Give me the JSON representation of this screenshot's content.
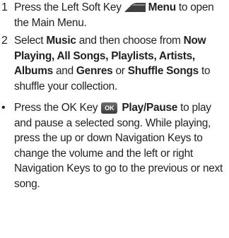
{
  "steps": [
    {
      "marker": "1",
      "pre": "Press the Left Soft Key",
      "icon": "left-soft-key-icon",
      "bold": "Menu",
      "post": " to open the Main Menu."
    },
    {
      "marker": "2",
      "t1": "Select ",
      "b1": "Music",
      "t2": " and then choose from ",
      "b2": "Now Playing, All Songs, Playlists, Artists, Albums",
      "t3": " and ",
      "b3": "Genres",
      "t4": " or ",
      "b4": "Shuffle Songs",
      "t5": " to shuffle your collection."
    },
    {
      "marker": "•",
      "pre": "Press the OK Key",
      "key_label": "OK",
      "bold": "Play/Pause",
      "post": " to play and pause a selected song. While playing, press the up or down Navigation Keys to change the volume and the left or right Navigation Keys to go to the previous or next song."
    }
  ],
  "colors": {
    "text": "#231f20",
    "key": "#4a4a4a"
  }
}
